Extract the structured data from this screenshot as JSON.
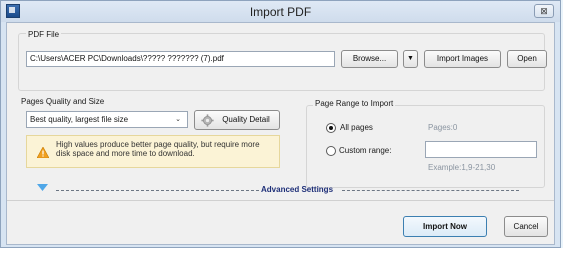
{
  "window": {
    "title": "Import PDF",
    "close_glyph": "⊠",
    "icon": "app-logo-icon"
  },
  "pdf_file": {
    "group_label": "PDF File",
    "path_value": "C:\\Users\\ACER PC\\Downloads\\????? ??????? (7).pdf",
    "browse_label": "Browse...",
    "dropdown_glyph": "▼",
    "import_images_label": "Import Images",
    "open_label": "Open"
  },
  "quality": {
    "group_label": "Pages Quality and Size",
    "selected_option": "Best quality, largest file size",
    "chevron_glyph": "⌄",
    "detail_button_label": "Quality Detail",
    "detail_icon": "gear-icon",
    "warning_icon": "warning-icon",
    "warning_text": "High values produce better page quality, but require more disk space and more time to download."
  },
  "page_range": {
    "group_label": "Page Range to Import",
    "all_pages_label": "All pages",
    "all_pages_selected": true,
    "pages_info": "Pages:0",
    "custom_range_label": "Custom range:",
    "custom_range_value": "",
    "example_text": "Example:1,9-21,30"
  },
  "advanced": {
    "label": "Advanced Settings",
    "expand_icon": "chevron-down-icon"
  },
  "actions": {
    "import_now_label": "Import Now",
    "cancel_label": "Cancel"
  },
  "colors": {
    "accent": "#1e2f78",
    "primary_border": "#3c7fb1"
  }
}
